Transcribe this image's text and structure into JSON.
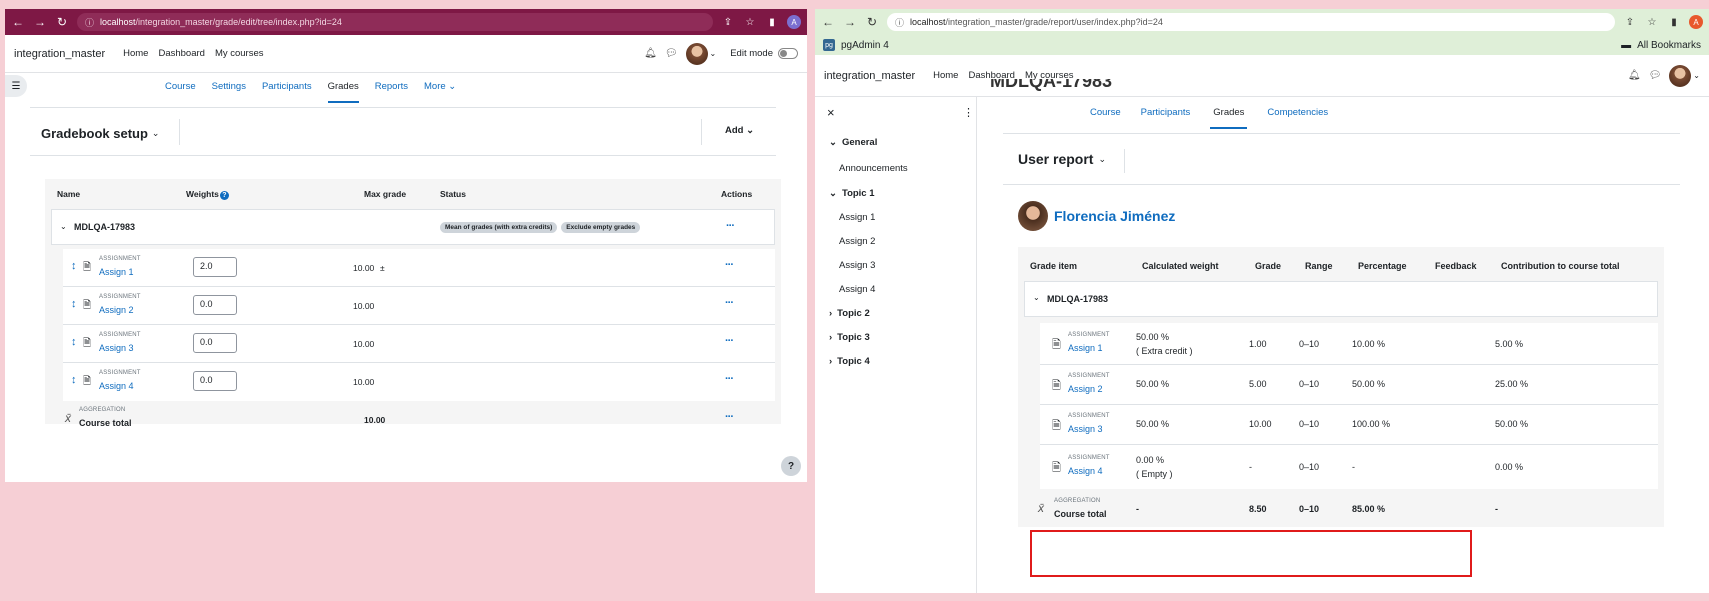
{
  "w1": {
    "url_host": "localhost",
    "url_path": "/integration_master/grade/edit/tree/index.php?id=24",
    "avatar_letter": "A",
    "brand": "integration_master",
    "nav": [
      "Home",
      "Dashboard",
      "My courses"
    ],
    "edit_mode": "Edit mode",
    "tabs": [
      "Course",
      "Settings",
      "Participants",
      "Grades",
      "Reports",
      "More"
    ],
    "page_title": "Gradebook setup",
    "add_label": "Add",
    "cols": {
      "name": "Name",
      "weights": "Weights",
      "max": "Max grade",
      "status": "Status",
      "actions": "Actions"
    },
    "category": {
      "name": "MDLQA-17983",
      "pill1": "Mean of grades (with extra credits)",
      "pill2": "Exclude empty grades"
    },
    "items": [
      {
        "type": "ASSIGNMENT",
        "name": "Assign 1",
        "weight": "2.0",
        "max": "10.00",
        "extra": "±"
      },
      {
        "type": "ASSIGNMENT",
        "name": "Assign 2",
        "weight": "0.0",
        "max": "10.00",
        "extra": ""
      },
      {
        "type": "ASSIGNMENT",
        "name": "Assign 3",
        "weight": "0.0",
        "max": "10.00",
        "extra": ""
      },
      {
        "type": "ASSIGNMENT",
        "name": "Assign 4",
        "weight": "0.0",
        "max": "10.00",
        "extra": ""
      }
    ],
    "total": {
      "type": "AGGREGATION",
      "name": "Course total",
      "max": "10.00"
    },
    "help": "?",
    "dots": "···"
  },
  "w2": {
    "url_host": "localhost",
    "url_path": "/integration_master/grade/report/user/index.php?id=24",
    "avatar_letter": "A",
    "bookmark": "pgAdmin 4",
    "all_bookmarks": "All Bookmarks",
    "brand": "integration_master",
    "nav": [
      "Home",
      "Dashboard",
      "My courses"
    ],
    "drawer": {
      "close": "×",
      "menu": "⋮",
      "items": [
        {
          "label": "General",
          "kind": "sec"
        },
        {
          "label": "Announcements",
          "kind": "sub"
        },
        {
          "label": "Topic 1",
          "kind": "sec"
        },
        {
          "label": "Assign 1",
          "kind": "sub"
        },
        {
          "label": "Assign 2",
          "kind": "sub"
        },
        {
          "label": "Assign 3",
          "kind": "sub"
        },
        {
          "label": "Assign 4",
          "kind": "sub"
        },
        {
          "label": "Topic 2",
          "kind": "sec"
        },
        {
          "label": "Topic 3",
          "kind": "sec"
        },
        {
          "label": "Topic 4",
          "kind": "sec"
        }
      ]
    },
    "course_title_partial": "MDLQA-17983",
    "tabs": [
      "Course",
      "Participants",
      "Grades",
      "Competencies"
    ],
    "page_title": "User report",
    "user_name": "Florencia Jiménez",
    "cols": [
      "Grade item",
      "Calculated weight",
      "Grade",
      "Range",
      "Percentage",
      "Feedback",
      "Contribution to course total"
    ],
    "category": "MDLQA-17983",
    "rows": [
      {
        "type": "ASSIGNMENT",
        "name": "Assign 1",
        "weight": "50.00 %",
        "weight2": "( Extra credit )",
        "grade": "1.00",
        "range": "0–10",
        "pct": "10.00 %",
        "feedback": "",
        "contrib": "5.00 %"
      },
      {
        "type": "ASSIGNMENT",
        "name": "Assign 2",
        "weight": "50.00 %",
        "weight2": "",
        "grade": "5.00",
        "range": "0–10",
        "pct": "50.00 %",
        "feedback": "",
        "contrib": "25.00 %"
      },
      {
        "type": "ASSIGNMENT",
        "name": "Assign 3",
        "weight": "50.00 %",
        "weight2": "",
        "grade": "10.00",
        "range": "0–10",
        "pct": "100.00 %",
        "feedback": "",
        "contrib": "50.00 %"
      },
      {
        "type": "ASSIGNMENT",
        "name": "Assign 4",
        "weight": "0.00 %",
        "weight2": "( Empty )",
        "grade": "-",
        "range": "0–10",
        "pct": "-",
        "feedback": "",
        "contrib": "0.00 %"
      }
    ],
    "total": {
      "type": "AGGREGATION",
      "name": "Course total",
      "weight": "-",
      "grade": "8.50",
      "range": "0–10",
      "pct": "85.00 %",
      "contrib": "-"
    }
  },
  "colors": {
    "accent": "#0f6cbf",
    "chrome1": "#7e1845",
    "chrome2": "#dfefd8",
    "highlight": "#e01b1b",
    "bg": "#f6cfd5"
  }
}
